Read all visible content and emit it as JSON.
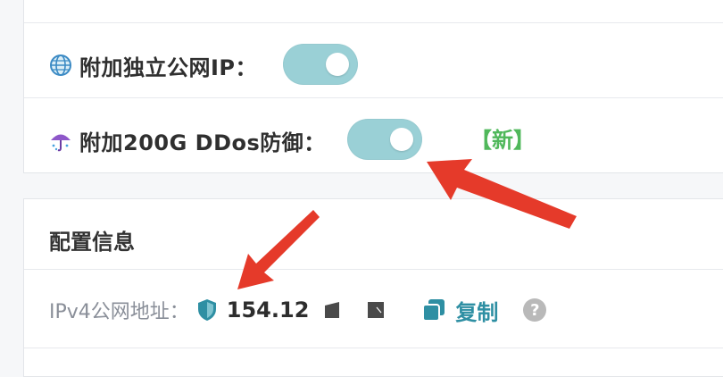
{
  "options": {
    "dedicated_ip_label": "附加独立公网IP：",
    "ddos_label": "附加200G DDos防御：",
    "ddos_new_tag": "【新】"
  },
  "config": {
    "title": "配置信息",
    "ipv4_label": "IPv4公网地址：",
    "ipv4_value": "154.12",
    "copy_label": "复制",
    "help_symbol": "?"
  },
  "icons": {
    "globe": "globe-icon",
    "umbrella": "umbrella-rain-icon",
    "shield": "shield-icon",
    "copy": "copy-icon",
    "help": "question-circle-icon"
  },
  "colors": {
    "toggle_on": "#9ad0d6",
    "link": "#2e8fa3",
    "new_tag": "#50b85b",
    "arrow": "#e53a2a"
  },
  "toggles": {
    "dedicated_ip_on": true,
    "ddos_on": true
  }
}
